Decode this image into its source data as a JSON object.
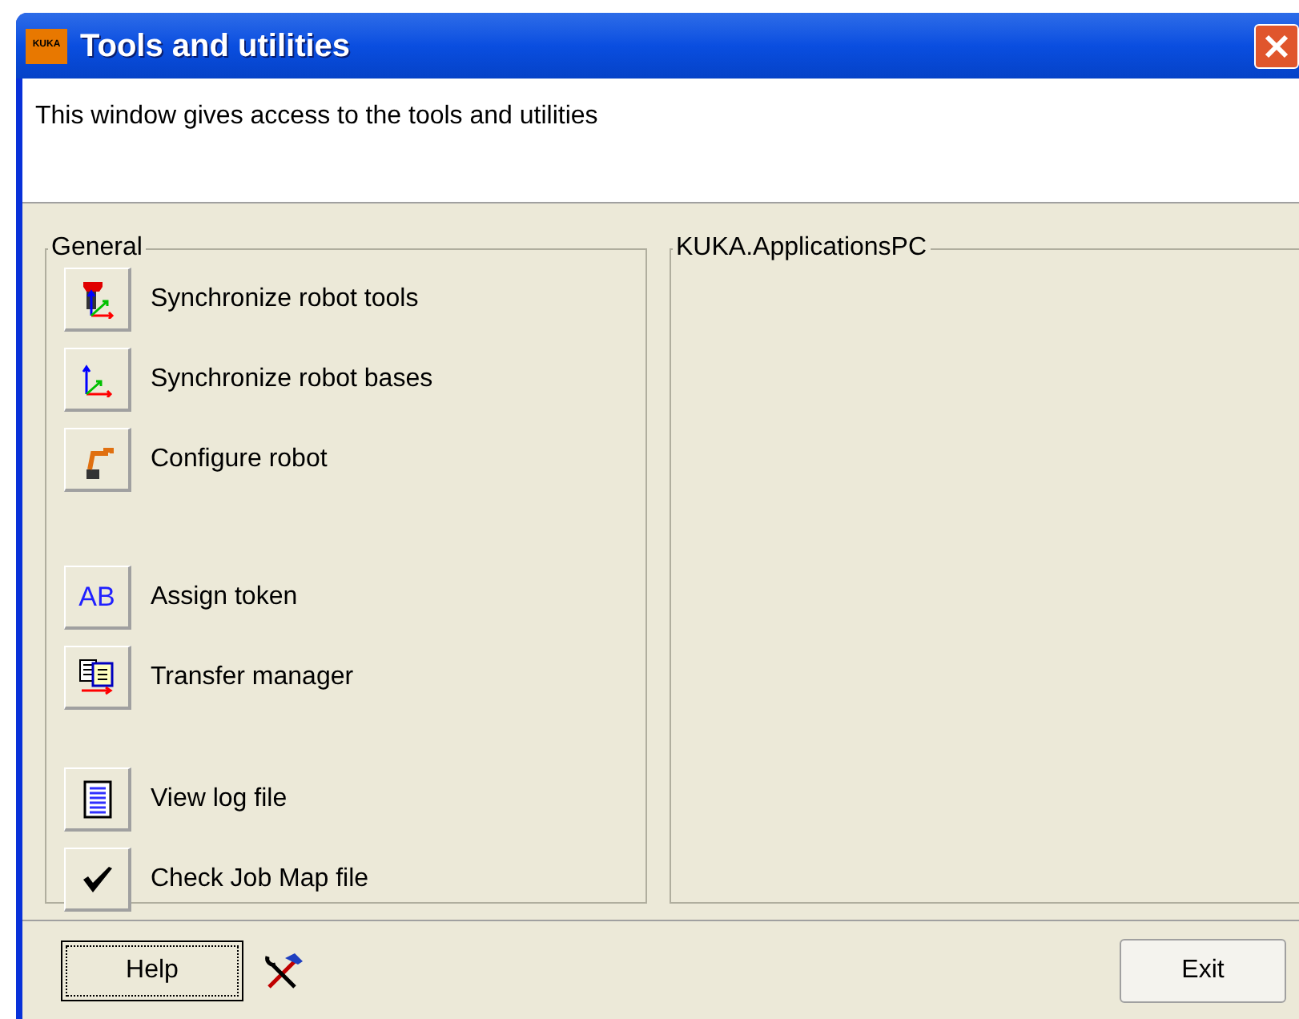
{
  "window": {
    "title": "Tools and utilities",
    "logo": "KUKA"
  },
  "description": "This window gives access to the tools and utilities",
  "general": {
    "title": "General",
    "groups": [
      [
        {
          "label": "Synchronize robot tools"
        },
        {
          "label": "Synchronize robot bases"
        },
        {
          "label": "Configure robot"
        }
      ],
      [
        {
          "label": "Assign token",
          "icon_text": "AB"
        },
        {
          "label": "Transfer manager"
        }
      ],
      [
        {
          "label": "View log file"
        },
        {
          "label": "Check Job Map file"
        }
      ]
    ]
  },
  "applications": {
    "title": "KUKA.ApplicationsPC"
  },
  "footer": {
    "help": "Help",
    "exit": "Exit"
  }
}
